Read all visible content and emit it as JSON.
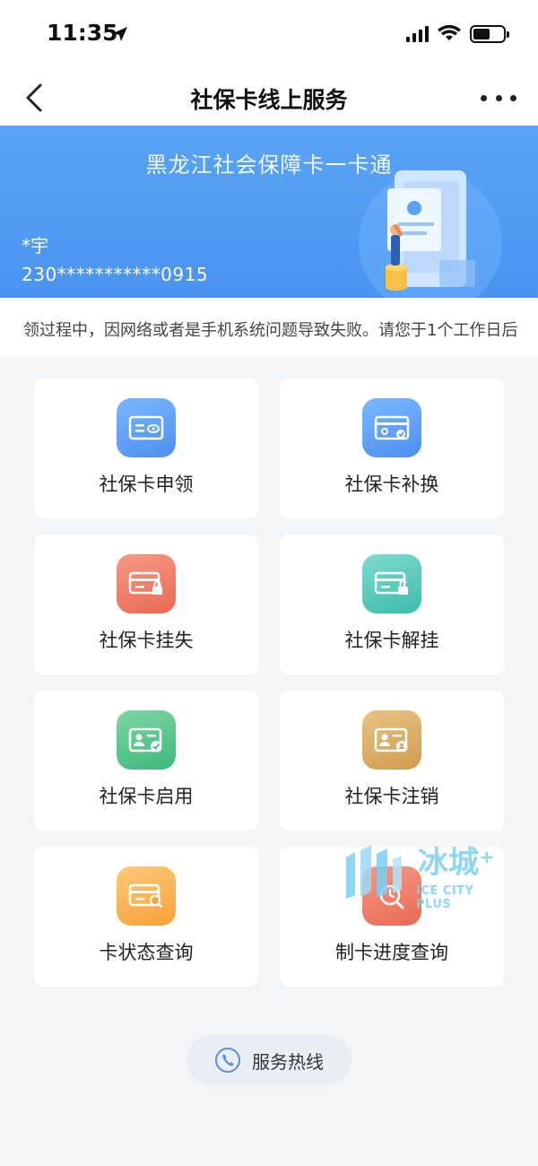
{
  "status_bar": {
    "time": "11:35"
  },
  "nav": {
    "title": "社保卡线上服务"
  },
  "banner": {
    "title": "黑龙江社会保障卡一卡通",
    "holder_name": "*宇",
    "holder_id": "230***********0915"
  },
  "notice": {
    "text": "领过程中，因网络或者是手机系统问题导致失败。请您于1个工作日后"
  },
  "services": [
    {
      "label": "社保卡申领",
      "icon": "card-view-icon",
      "color": "#4d8ff0"
    },
    {
      "label": "社保卡补换",
      "icon": "card-replace-icon",
      "color": "#4d8ff0"
    },
    {
      "label": "社保卡挂失",
      "icon": "card-lock-icon",
      "color": "#e96a55"
    },
    {
      "label": "社保卡解挂",
      "icon": "card-unlock-icon",
      "color": "#3dbbad"
    },
    {
      "label": "社保卡启用",
      "icon": "card-activate-icon",
      "color": "#3db879"
    },
    {
      "label": "社保卡注销",
      "icon": "card-cancel-icon",
      "color": "#cf9c4f"
    },
    {
      "label": "卡状态查询",
      "icon": "card-search-icon",
      "color": "#f7a136"
    },
    {
      "label": "制卡进度查询",
      "icon": "progress-search-icon",
      "color": "#e96a55"
    }
  ],
  "hotline": {
    "label": "服务热线"
  },
  "watermark": {
    "cn": "冰城⁺",
    "en": "ICE CITY PLUS"
  }
}
